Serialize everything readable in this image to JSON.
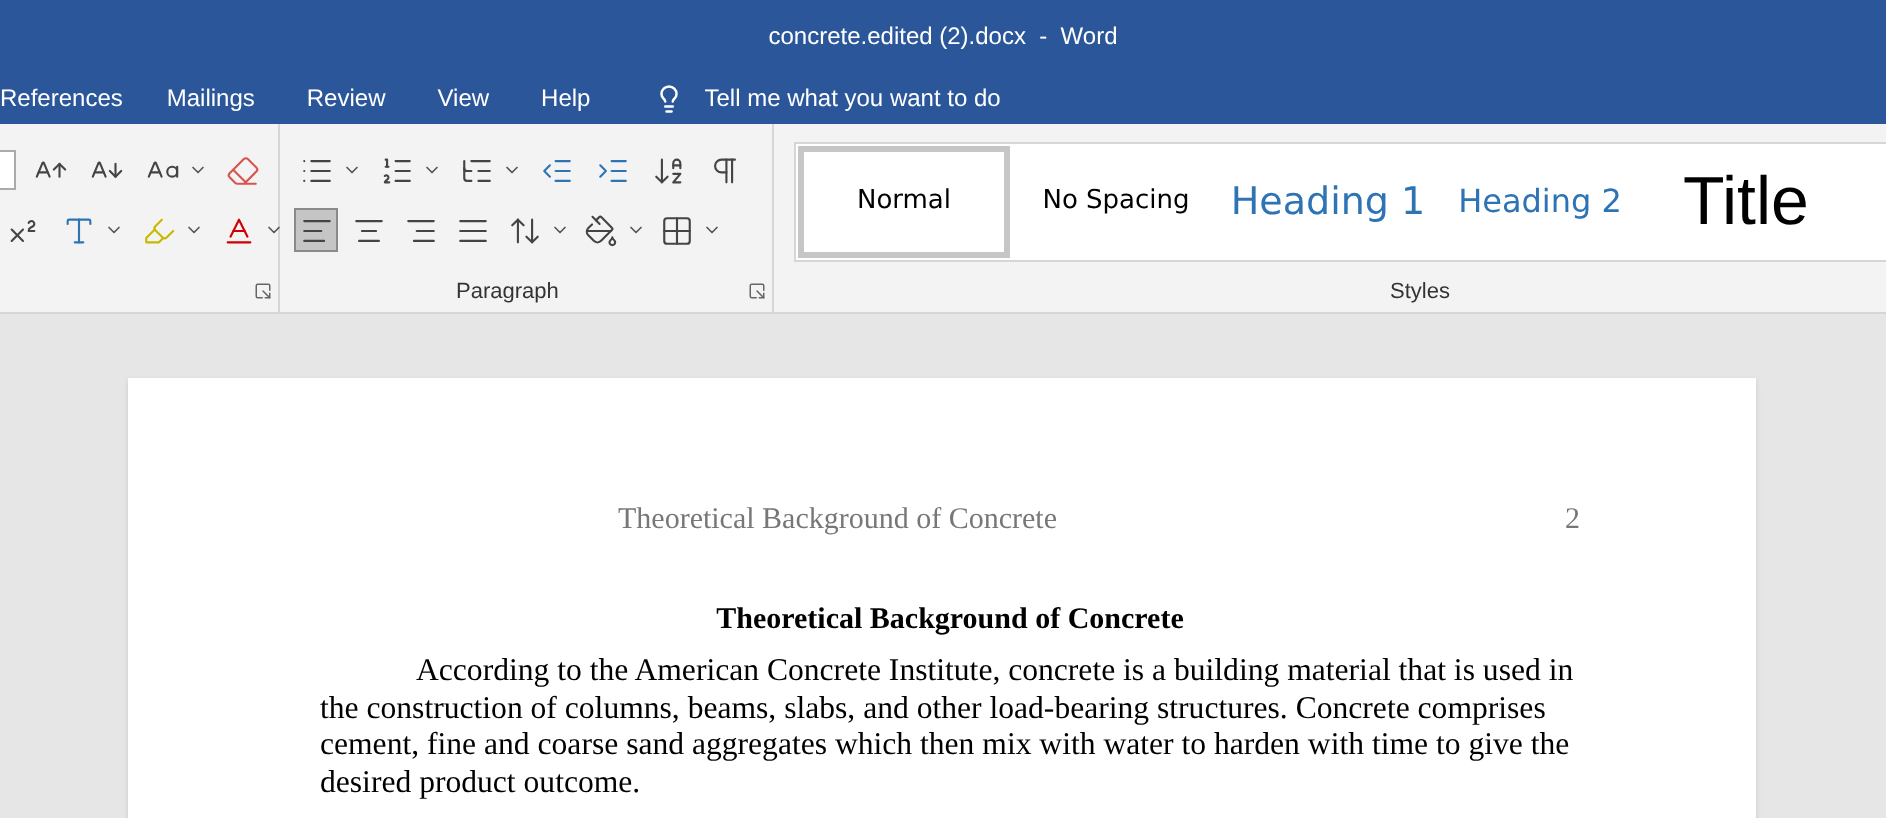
{
  "window": {
    "title": "concrete.edited (2).docx  -  Word"
  },
  "tabs": [
    {
      "label": "References"
    },
    {
      "label": "Mailings"
    },
    {
      "label": "Review"
    },
    {
      "label": "View"
    },
    {
      "label": "Help"
    }
  ],
  "tell_me": {
    "placeholder": "Tell me what you want to do"
  },
  "ribbon": {
    "paragraph_label": "Paragraph",
    "styles_label": "Styles",
    "alignment": [
      {
        "kind": "left",
        "selected": true
      },
      {
        "kind": "center",
        "selected": false
      },
      {
        "kind": "right",
        "selected": false
      },
      {
        "kind": "justify",
        "selected": false
      }
    ],
    "styles": [
      {
        "label": "Normal",
        "kind": "normal",
        "selected": true
      },
      {
        "label": "No Spacing",
        "kind": "normal",
        "selected": false
      },
      {
        "label": "Heading 1",
        "kind": "heading1",
        "selected": false
      },
      {
        "label": "Heading 2",
        "kind": "heading2",
        "selected": false
      },
      {
        "label": "Title",
        "kind": "title",
        "selected": false
      }
    ]
  },
  "document": {
    "header": "Theoretical Background of Concrete",
    "page_number": "2",
    "heading": "Theoretical Background of Concrete",
    "paragraph": "According to the American Concrete Institute, concrete is a building material that is used in the construction of columns, beams, slabs, and other load-bearing structures. Concrete comprises cement, fine and coarse sand aggregates which then mix with water to harden with time to give the desired product outcome."
  }
}
